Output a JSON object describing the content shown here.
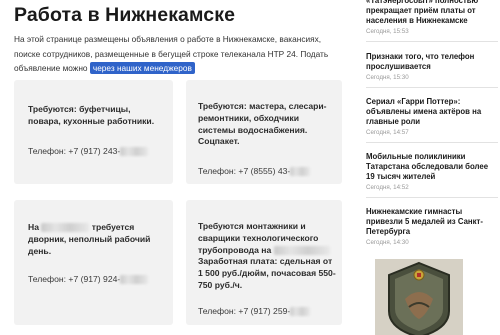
{
  "page": {
    "title": "Работа в Нижнекамске",
    "intro_text": "На этой странице размещены объявления о работе в Нижнекамске, вакансиях, поиске сотрудников, размещенные в бегущей строке телеканала НТР 24. Подать объявление можно",
    "intro_link": "через наших менеджеров"
  },
  "cards": [
    {
      "text": "Требуются: буфетчицы, повара, кухонные работники.",
      "phone": "Телефон: +7 (917) 243-"
    },
    {
      "text": "Требуются: мастера, слесари-ремонтники, обходчики системы водоснабжения. Соцпакет.",
      "phone": "Телефон: +7 (8555) 43-"
    },
    {
      "text_prefix": "На",
      "text_suffix": "требуется",
      "text_rest": "дворник, неполный рабочий день.",
      "phone": "Телефон: +7 (917) 924-"
    },
    {
      "text": "Требуются монтажники и сварщики технологического трубопровода на",
      "text_rest": "Заработная плата: сдельная от 1 500 руб./дюйм, почасовая 550-750 руб./ч.",
      "phone": "Телефон: +7 (917) 259-"
    }
  ],
  "sidebar": {
    "news": [
      {
        "title": "«Татэнергосбыт» полностью прекращает приём платы от населения в Нижнекамске",
        "time": "Сегодня, 15:53"
      },
      {
        "title": "Признаки того, что телефон прослушивается",
        "time": "Сегодня, 15:30"
      },
      {
        "title": "Сериал «Гарри Поттер»: объявлены имена актёров на главные роли",
        "time": "Сегодня, 14:57"
      },
      {
        "title": "Мобильные поликлиники Татарстана обследовали более 19 тысяч жителей",
        "time": "Сегодня, 14:52"
      },
      {
        "title": "Нижнекамские гимнасты привезли 5 медалей из Санкт-Петербурга",
        "time": "Сегодня, 14:30"
      }
    ]
  }
}
